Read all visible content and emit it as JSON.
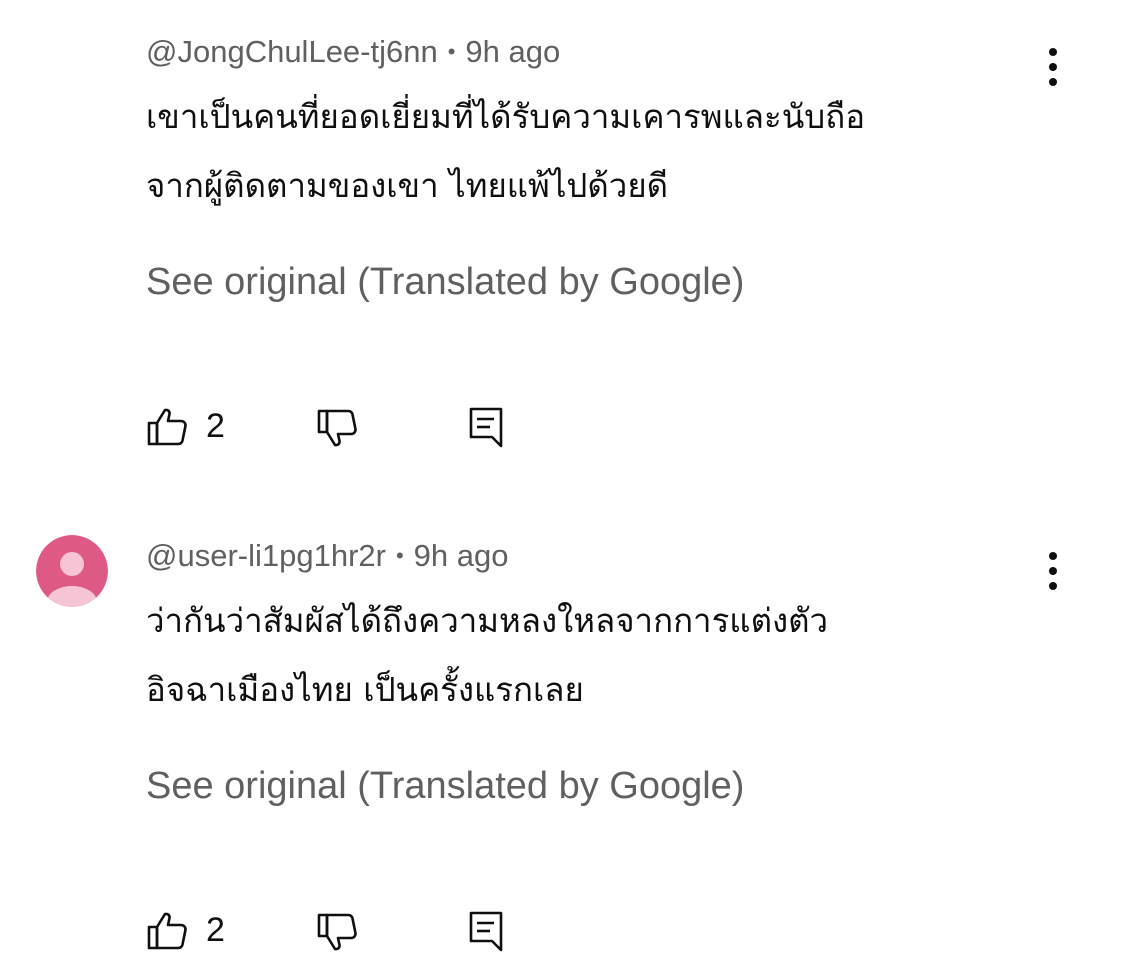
{
  "colors": {
    "text_primary": "#0f0f0f",
    "text_secondary": "#606060",
    "avatar_bg": "#de5a85",
    "avatar_fg": "#f6c4d4"
  },
  "comments": [
    {
      "handle": "@JongChulLee-tj6nn",
      "separator": "•",
      "time": "9h ago",
      "text_line1": "เขาเป็นคนที่ยอดเยี่ยมที่ได้รับความเคารพและนับถือ",
      "text_line2": "จากผู้ติดตามของเขา ไทยแพ้ไปด้วยดี",
      "translate_link": "See original (Translated by Google)",
      "like_count": "2",
      "avatar_visible": false,
      "icons": {
        "menu": "more-vert-icon",
        "like": "thumbs-up-icon",
        "dislike": "thumbs-down-icon",
        "reply": "reply-comment-icon"
      }
    },
    {
      "handle": "@user-li1pg1hr2r",
      "separator": "•",
      "time": "9h ago",
      "text_line1": "ว่ากันว่าสัมผัสได้ถึงความหลงใหลจากการแต่งตัว",
      "text_line2": "อิจฉาเมืองไทย เป็นครั้งแรกเลย",
      "translate_link": "See original (Translated by Google)",
      "like_count": "2",
      "avatar_visible": true,
      "icons": {
        "avatar": "default-avatar-icon",
        "menu": "more-vert-icon",
        "like": "thumbs-up-icon",
        "dislike": "thumbs-down-icon",
        "reply": "reply-comment-icon"
      }
    }
  ]
}
